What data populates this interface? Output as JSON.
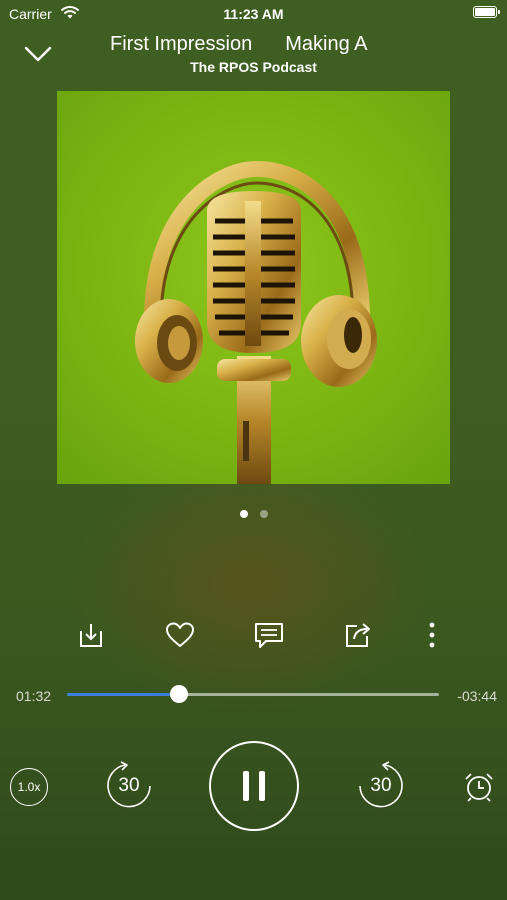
{
  "status_bar": {
    "carrier": "Carrier",
    "time": "11:23 AM",
    "battery_level": 1.0
  },
  "header": {
    "title_parts": [
      "First Impression",
      "Making A"
    ],
    "podcast": "The RPOS Podcast"
  },
  "artwork": {
    "subject": "gold microphone with headphones",
    "background": "#7bb513"
  },
  "pager": {
    "pages": 2,
    "current": 1
  },
  "actions": [
    "download-icon",
    "heart-icon",
    "comments-icon",
    "share-icon",
    "more-icon"
  ],
  "progress": {
    "elapsed": "01:32",
    "remaining": "-03:44",
    "fraction": 0.3,
    "fill_color": "#3b7dd8"
  },
  "controls": {
    "speed": "1.0x",
    "skip_back": "30",
    "skip_forward": "30"
  }
}
